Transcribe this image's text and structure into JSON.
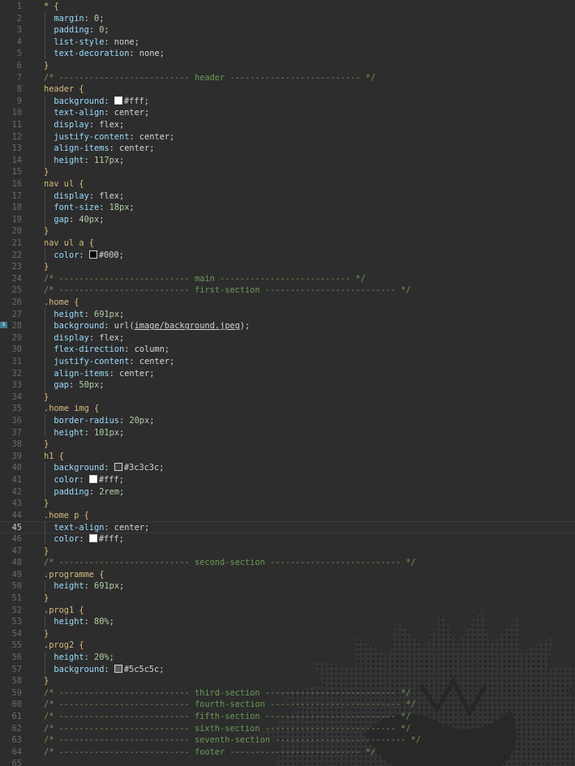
{
  "editor": {
    "language": "CSS",
    "active_line": 45,
    "bookmark_line": 28,
    "bookmark_label": "5",
    "watermark_icon": "decorative-lion-illustration"
  },
  "colors": {
    "background": "#2d2d2d",
    "comment": "#6a9955",
    "selector": "#d7ba7d",
    "property": "#9cdcfe",
    "number": "#b5cea8"
  },
  "lines": [
    {
      "n": 1,
      "t": [
        [
          "sel",
          "* "
        ],
        [
          "brace",
          "{"
        ]
      ]
    },
    {
      "n": 2,
      "t": [
        [
          "val",
          "  "
        ],
        [
          "prop",
          "margin"
        ],
        [
          "val",
          ": "
        ],
        [
          "num",
          "0"
        ],
        [
          "val",
          ";"
        ]
      ]
    },
    {
      "n": 3,
      "t": [
        [
          "val",
          "  "
        ],
        [
          "prop",
          "padding"
        ],
        [
          "val",
          ": "
        ],
        [
          "num",
          "0"
        ],
        [
          "val",
          ";"
        ]
      ]
    },
    {
      "n": 4,
      "t": [
        [
          "val",
          "  "
        ],
        [
          "prop",
          "list-style"
        ],
        [
          "val",
          ": none;"
        ]
      ]
    },
    {
      "n": 5,
      "t": [
        [
          "val",
          "  "
        ],
        [
          "prop",
          "text-decoration"
        ],
        [
          "val",
          ": none;"
        ]
      ]
    },
    {
      "n": 6,
      "t": [
        [
          "brace",
          "}"
        ]
      ]
    },
    {
      "n": 7,
      "t": [
        [
          "cmt",
          "/* -------------------------- header -------------------------- */"
        ]
      ]
    },
    {
      "n": 8,
      "t": [
        [
          "tag",
          "header "
        ],
        [
          "brace",
          "{"
        ]
      ]
    },
    {
      "n": 9,
      "t": [
        [
          "val",
          "  "
        ],
        [
          "prop",
          "background"
        ],
        [
          "val",
          ": "
        ],
        [
          "sw",
          "#ffffff"
        ],
        [
          "val",
          "#fff;"
        ]
      ]
    },
    {
      "n": 10,
      "t": [
        [
          "val",
          "  "
        ],
        [
          "prop",
          "text-align"
        ],
        [
          "val",
          ": center;"
        ]
      ]
    },
    {
      "n": 11,
      "t": [
        [
          "val",
          "  "
        ],
        [
          "prop",
          "display"
        ],
        [
          "val",
          ": flex;"
        ]
      ]
    },
    {
      "n": 12,
      "t": [
        [
          "val",
          "  "
        ],
        [
          "prop",
          "justify-content"
        ],
        [
          "val",
          ": center;"
        ]
      ]
    },
    {
      "n": 13,
      "t": [
        [
          "val",
          "  "
        ],
        [
          "prop",
          "align-items"
        ],
        [
          "val",
          ": center;"
        ]
      ]
    },
    {
      "n": 14,
      "t": [
        [
          "val",
          "  "
        ],
        [
          "prop",
          "height"
        ],
        [
          "val",
          ": "
        ],
        [
          "num",
          "117px"
        ],
        [
          "val",
          ";"
        ]
      ]
    },
    {
      "n": 15,
      "t": [
        [
          "brace",
          "}"
        ]
      ]
    },
    {
      "n": 16,
      "t": [
        [
          "tag",
          "nav ul "
        ],
        [
          "brace",
          "{"
        ]
      ]
    },
    {
      "n": 17,
      "t": [
        [
          "val",
          "  "
        ],
        [
          "prop",
          "display"
        ],
        [
          "val",
          ": flex;"
        ]
      ]
    },
    {
      "n": 18,
      "t": [
        [
          "val",
          "  "
        ],
        [
          "prop",
          "font-size"
        ],
        [
          "val",
          ": "
        ],
        [
          "num",
          "18px"
        ],
        [
          "val",
          ";"
        ]
      ]
    },
    {
      "n": 19,
      "t": [
        [
          "val",
          "  "
        ],
        [
          "prop",
          "gap"
        ],
        [
          "val",
          ": "
        ],
        [
          "num",
          "40px"
        ],
        [
          "val",
          ";"
        ]
      ]
    },
    {
      "n": 20,
      "t": [
        [
          "brace",
          "}"
        ]
      ]
    },
    {
      "n": 21,
      "t": [
        [
          "tag",
          "nav ul a "
        ],
        [
          "brace",
          "{"
        ]
      ]
    },
    {
      "n": 22,
      "t": [
        [
          "val",
          "  "
        ],
        [
          "prop",
          "color"
        ],
        [
          "val",
          ": "
        ],
        [
          "sw",
          "#000000"
        ],
        [
          "val",
          "#000;"
        ]
      ]
    },
    {
      "n": 23,
      "t": [
        [
          "brace",
          "}"
        ]
      ]
    },
    {
      "n": 24,
      "t": [
        [
          "cmt",
          "/* -------------------------- main -------------------------- */"
        ]
      ]
    },
    {
      "n": 25,
      "t": [
        [
          "cmt",
          "/* -------------------------- first-section -------------------------- */"
        ]
      ]
    },
    {
      "n": 26,
      "t": [
        [
          "cls",
          ".home "
        ],
        [
          "brace",
          "{"
        ]
      ]
    },
    {
      "n": 27,
      "t": [
        [
          "val",
          "  "
        ],
        [
          "prop",
          "height"
        ],
        [
          "val",
          ": "
        ],
        [
          "num",
          "691px"
        ],
        [
          "val",
          ";"
        ]
      ]
    },
    {
      "n": 28,
      "t": [
        [
          "val",
          "  "
        ],
        [
          "prop",
          "background"
        ],
        [
          "val",
          ": url("
        ],
        [
          "url",
          "image/background.jpeg"
        ],
        [
          "val",
          ");"
        ]
      ]
    },
    {
      "n": 29,
      "t": [
        [
          "val",
          "  "
        ],
        [
          "prop",
          "display"
        ],
        [
          "val",
          ": flex;"
        ]
      ]
    },
    {
      "n": 30,
      "t": [
        [
          "val",
          "  "
        ],
        [
          "prop",
          "flex-direction"
        ],
        [
          "val",
          ": column;"
        ]
      ]
    },
    {
      "n": 31,
      "t": [
        [
          "val",
          "  "
        ],
        [
          "prop",
          "justify-content"
        ],
        [
          "val",
          ": center;"
        ]
      ]
    },
    {
      "n": 32,
      "t": [
        [
          "val",
          "  "
        ],
        [
          "prop",
          "align-items"
        ],
        [
          "val",
          ": center;"
        ]
      ]
    },
    {
      "n": 33,
      "t": [
        [
          "val",
          "  "
        ],
        [
          "prop",
          "gap"
        ],
        [
          "val",
          ": "
        ],
        [
          "num",
          "50px"
        ],
        [
          "val",
          ";"
        ]
      ]
    },
    {
      "n": 34,
      "t": [
        [
          "brace",
          "}"
        ]
      ]
    },
    {
      "n": 35,
      "t": [
        [
          "cls",
          ".home img "
        ],
        [
          "brace",
          "{"
        ]
      ]
    },
    {
      "n": 36,
      "t": [
        [
          "val",
          "  "
        ],
        [
          "prop",
          "border-radius"
        ],
        [
          "val",
          ": "
        ],
        [
          "num",
          "20px"
        ],
        [
          "val",
          ";"
        ]
      ]
    },
    {
      "n": 37,
      "t": [
        [
          "val",
          "  "
        ],
        [
          "prop",
          "height"
        ],
        [
          "val",
          ": "
        ],
        [
          "num",
          "101px"
        ],
        [
          "val",
          ";"
        ]
      ]
    },
    {
      "n": 38,
      "t": [
        [
          "brace",
          "}"
        ]
      ]
    },
    {
      "n": 39,
      "t": [
        [
          "tag",
          "h1 "
        ],
        [
          "brace",
          "{"
        ]
      ]
    },
    {
      "n": 40,
      "t": [
        [
          "val",
          "  "
        ],
        [
          "prop",
          "background"
        ],
        [
          "val",
          ": "
        ],
        [
          "sw",
          "#3c3c3c"
        ],
        [
          "val",
          "#3c3c3c;"
        ]
      ]
    },
    {
      "n": 41,
      "t": [
        [
          "val",
          "  "
        ],
        [
          "prop",
          "color"
        ],
        [
          "val",
          ": "
        ],
        [
          "sw",
          "#ffffff"
        ],
        [
          "val",
          "#fff;"
        ]
      ]
    },
    {
      "n": 42,
      "t": [
        [
          "val",
          "  "
        ],
        [
          "prop",
          "padding"
        ],
        [
          "val",
          ": "
        ],
        [
          "num",
          "2rem"
        ],
        [
          "val",
          ";"
        ]
      ]
    },
    {
      "n": 43,
      "t": [
        [
          "brace",
          "}"
        ]
      ]
    },
    {
      "n": 44,
      "t": [
        [
          "cls",
          ".home p "
        ],
        [
          "brace",
          "{"
        ]
      ]
    },
    {
      "n": 45,
      "t": [
        [
          "val",
          "  "
        ],
        [
          "prop",
          "text-align"
        ],
        [
          "val",
          ": center;"
        ]
      ]
    },
    {
      "n": 46,
      "t": [
        [
          "val",
          "  "
        ],
        [
          "prop",
          "color"
        ],
        [
          "val",
          ": "
        ],
        [
          "sw",
          "#ffffff"
        ],
        [
          "val",
          "#fff;"
        ]
      ]
    },
    {
      "n": 47,
      "t": [
        [
          "brace",
          "}"
        ]
      ]
    },
    {
      "n": 48,
      "t": [
        [
          "cmt",
          "/* -------------------------- second-section -------------------------- */"
        ]
      ]
    },
    {
      "n": 49,
      "t": [
        [
          "cls",
          ".programme "
        ],
        [
          "brace",
          "{"
        ]
      ]
    },
    {
      "n": 50,
      "t": [
        [
          "val",
          "  "
        ],
        [
          "prop",
          "height"
        ],
        [
          "val",
          ": "
        ],
        [
          "num",
          "691px"
        ],
        [
          "val",
          ";"
        ]
      ]
    },
    {
      "n": 51,
      "t": [
        [
          "brace",
          "}"
        ]
      ]
    },
    {
      "n": 52,
      "t": [
        [
          "cls",
          ".prog1 "
        ],
        [
          "brace",
          "{"
        ]
      ]
    },
    {
      "n": 53,
      "t": [
        [
          "val",
          "  "
        ],
        [
          "prop",
          "height"
        ],
        [
          "val",
          ": "
        ],
        [
          "num",
          "80%"
        ],
        [
          "val",
          ";"
        ]
      ]
    },
    {
      "n": 54,
      "t": [
        [
          "brace",
          "}"
        ]
      ]
    },
    {
      "n": 55,
      "t": [
        [
          "cls",
          ".prog2 "
        ],
        [
          "brace",
          "{"
        ]
      ]
    },
    {
      "n": 56,
      "t": [
        [
          "val",
          "  "
        ],
        [
          "prop",
          "height"
        ],
        [
          "val",
          ": "
        ],
        [
          "num",
          "20%"
        ],
        [
          "val",
          ";"
        ]
      ]
    },
    {
      "n": 57,
      "t": [
        [
          "val",
          "  "
        ],
        [
          "prop",
          "background"
        ],
        [
          "val",
          ": "
        ],
        [
          "sw",
          "#5c5c5c"
        ],
        [
          "val",
          "#5c5c5c;"
        ]
      ]
    },
    {
      "n": 58,
      "t": [
        [
          "brace",
          "}"
        ]
      ]
    },
    {
      "n": 59,
      "t": [
        [
          "cmt",
          "/* -------------------------- third-section -------------------------- */"
        ]
      ]
    },
    {
      "n": 60,
      "t": [
        [
          "cmt",
          "/* -------------------------- fourth-section -------------------------- */"
        ]
      ]
    },
    {
      "n": 61,
      "t": [
        [
          "cmt",
          "/* -------------------------- fifth-section -------------------------- */"
        ]
      ]
    },
    {
      "n": 62,
      "t": [
        [
          "cmt",
          "/* -------------------------- sixth-section -------------------------- */"
        ]
      ]
    },
    {
      "n": 63,
      "t": [
        [
          "cmt",
          "/* -------------------------- seventh-section -------------------------- */"
        ]
      ]
    },
    {
      "n": 64,
      "t": [
        [
          "cmt",
          "/* -------------------------- footer -------------------------- */"
        ]
      ]
    },
    {
      "n": 65,
      "t": []
    }
  ]
}
